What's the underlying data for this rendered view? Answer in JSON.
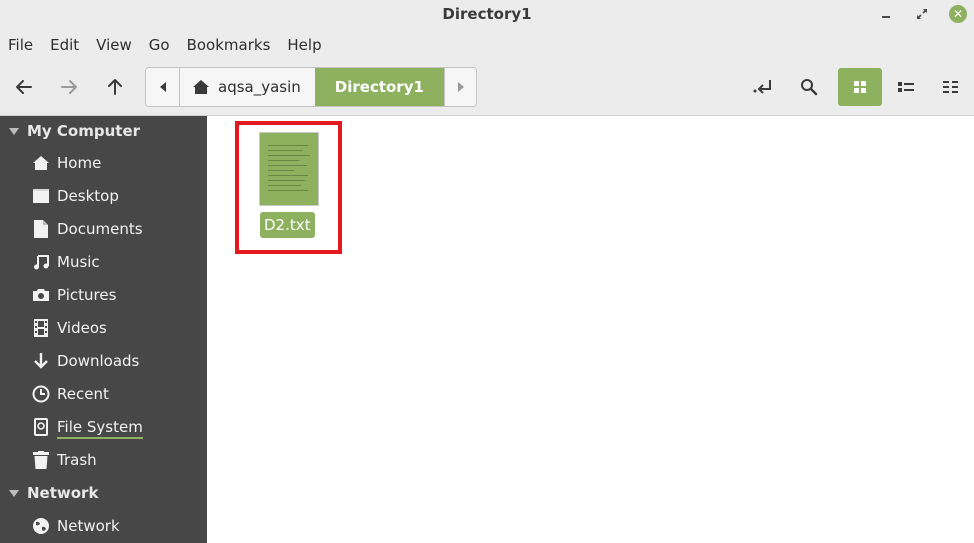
{
  "window": {
    "title": "Directory1"
  },
  "menu": {
    "items": [
      "File",
      "Edit",
      "View",
      "Go",
      "Bookmarks",
      "Help"
    ]
  },
  "toolbar": {
    "buttons": [
      "back-arrow-icon",
      "forward-arrow-icon",
      "up-arrow-icon",
      "toggle-location-icon",
      "search-icon"
    ],
    "views": [
      "icon-view",
      "list-view",
      "compact-view"
    ],
    "active_view": "icon-view"
  },
  "pathbar": {
    "crumbs": [
      "aqsa_yasin",
      "Directory1"
    ],
    "active": "Directory1"
  },
  "sidebar": {
    "sections": [
      {
        "label": "My Computer",
        "items": [
          "Home",
          "Desktop",
          "Documents",
          "Music",
          "Pictures",
          "Videos",
          "Downloads",
          "Recent",
          "File System",
          "Trash"
        ]
      },
      {
        "label": "Network",
        "items": [
          "Network"
        ]
      }
    ]
  },
  "files": [
    {
      "name": "D2.txt",
      "type": "text"
    }
  ],
  "colors": {
    "accent": "#8db15e",
    "sidebar_bg": "#474747",
    "highlight": "#e3191f",
    "chrome_bg": "#ececec"
  }
}
